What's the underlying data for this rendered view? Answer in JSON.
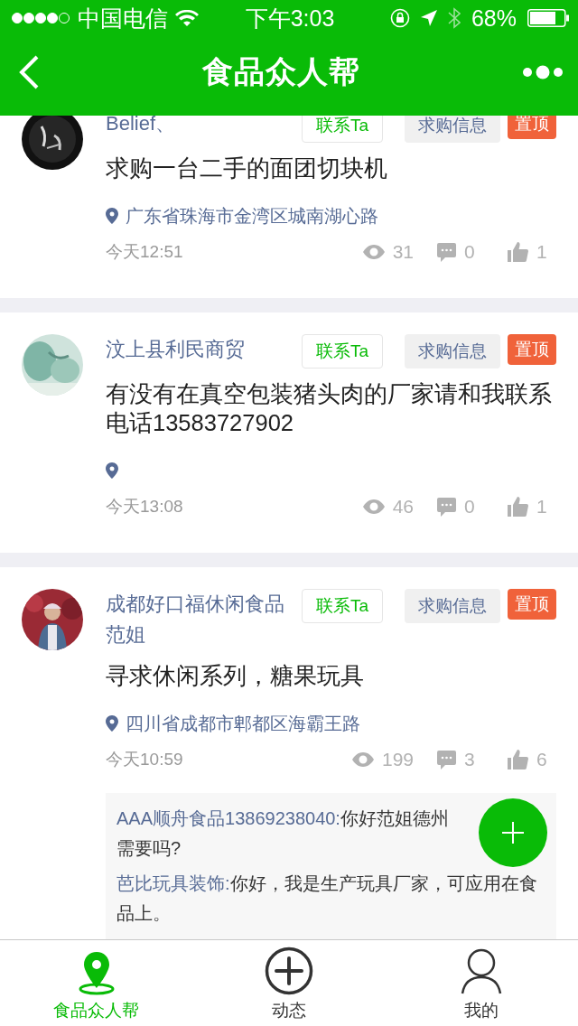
{
  "status_bar": {
    "carrier": "中国电信",
    "time": "下午3:03",
    "battery": "68%"
  },
  "nav": {
    "title": "食品众人帮"
  },
  "posts": [
    {
      "author": "Belief、",
      "tags": [
        {
          "kind": "contact",
          "label": "联系Ta"
        },
        {
          "kind": "category",
          "label": "求购信息"
        },
        {
          "kind": "pinned",
          "label": "置顶"
        }
      ],
      "content": "求购一台二手的面团切块机",
      "location": "广东省珠海市金湾区城南湖心路",
      "time": "今天12:51",
      "views": "31",
      "comments_count": "0",
      "likes": "1"
    },
    {
      "author": "汶上县利民商贸",
      "tags": [
        {
          "kind": "contact",
          "label": "联系Ta"
        },
        {
          "kind": "category",
          "label": "求购信息"
        },
        {
          "kind": "pinned",
          "label": "置顶"
        }
      ],
      "content": "有没有在真空包装猪头肉的厂家请和我联系电话13583727902",
      "time": "今天13:08",
      "views": "46",
      "comments_count": "0",
      "likes": "1"
    },
    {
      "author": "成都好口福休闲食品范姐",
      "tags": [
        {
          "kind": "contact",
          "label": "联系Ta"
        },
        {
          "kind": "category",
          "label": "求购信息"
        },
        {
          "kind": "pinned",
          "label": "置顶"
        }
      ],
      "content": "寻求休闲系列，糖果玩具",
      "location": "四川省成都市郫都区海霸王路",
      "time": "今天10:59",
      "views": "199",
      "comments_count": "3",
      "likes": "6",
      "comments": [
        {
          "author": "AAA顺舟食品13869238040:",
          "lines": [
            "你好范姐德州",
            "需要吗?"
          ]
        },
        {
          "author": "芭比玩具装饰:",
          "lines": [
            "你好，我是生产玩具厂家，可应用在食品上。"
          ]
        }
      ]
    }
  ],
  "tab_bar": [
    {
      "label": "食品众人帮",
      "selected": true
    },
    {
      "label": "动态",
      "selected": false
    },
    {
      "label": "我的",
      "selected": false
    }
  ]
}
